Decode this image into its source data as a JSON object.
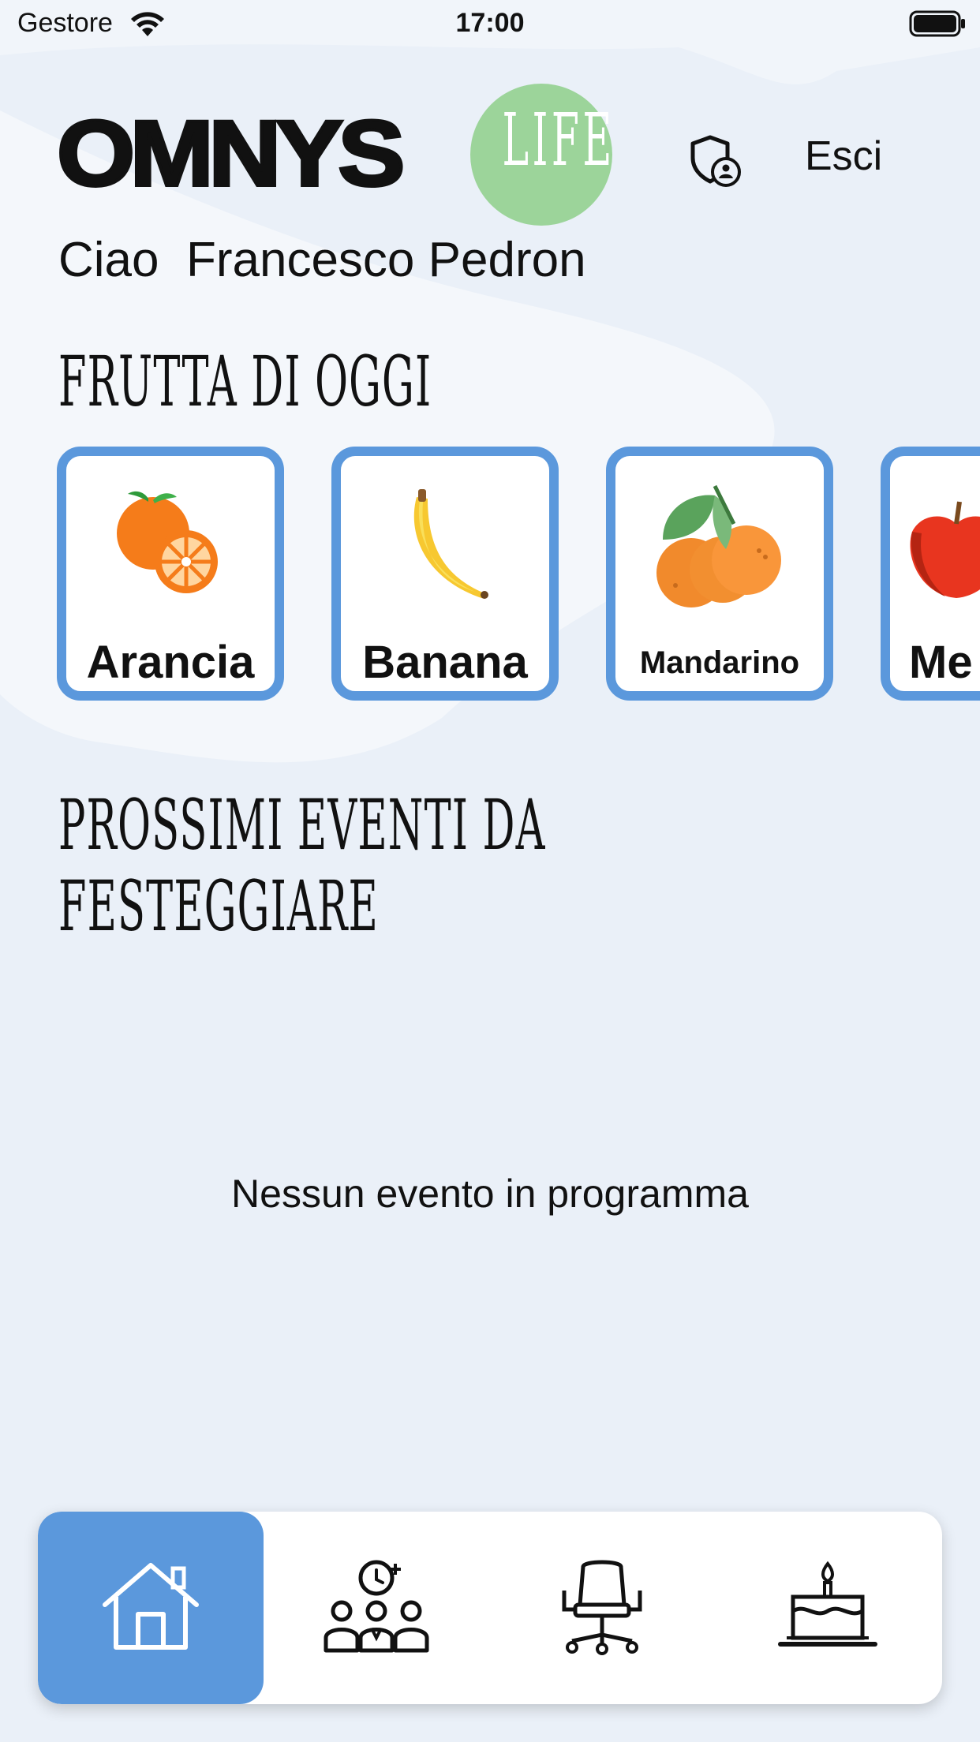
{
  "status_bar": {
    "carrier": "Gestore",
    "time": "17:00"
  },
  "header": {
    "logo_text": "OMNYS",
    "logo_life_text": "LIFE",
    "logout_label": "Esci"
  },
  "greeting": {
    "text": "Ciao  Francesco Pedron"
  },
  "fruit_section": {
    "title": "FRUTTA DI OGGI",
    "items": [
      {
        "label": "Arancia"
      },
      {
        "label": "Banana"
      },
      {
        "label": "Mandarino"
      },
      {
        "label": "Me"
      }
    ]
  },
  "events_section": {
    "title": "PROSSIMI EVENTI DA FESTEGGIARE",
    "empty_message": "Nessun evento in programma"
  },
  "tab_bar": {
    "tabs": [
      {
        "icon": "home-icon",
        "active": true
      },
      {
        "icon": "meeting-booking-icon",
        "active": false
      },
      {
        "icon": "office-chair-icon",
        "active": false
      },
      {
        "icon": "birthday-cake-icon",
        "active": false
      }
    ]
  },
  "colors": {
    "background": "#eaf0f8",
    "accent_blue": "#5b98dc",
    "logo_green": "#9cd49a"
  }
}
